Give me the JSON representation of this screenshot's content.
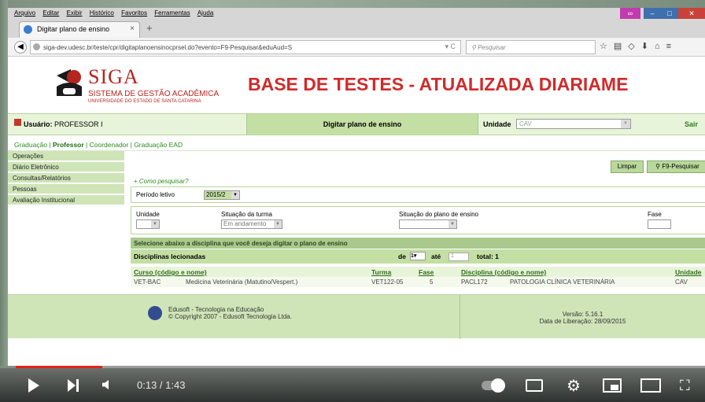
{
  "colors": {
    "brand_red": "#b52520",
    "banner_red": "#d12a2a",
    "green_light": "#e8f4d9",
    "green_mid": "#c3dfa3",
    "green_link": "#2e8b1e",
    "youtube_red": "#e62117"
  },
  "browser": {
    "menu": [
      "Arquivo",
      "Editar",
      "Exibir",
      "Histórico",
      "Favoritos",
      "Ferramentas",
      "Ajuda"
    ],
    "tab_title": "Digitar plano de ensino",
    "url": "siga-dev.udesc.br/teste/cpr/digitaplanoensinocprsel.do?evento=F9-Pesquisar&eduAud=S",
    "search_placeholder": "Pesquisar",
    "nav_icons": [
      "star-icon",
      "bookmarks-icon",
      "pocket-icon",
      "download-icon",
      "home-icon",
      "menu-icon"
    ]
  },
  "header": {
    "logo_title": "SIGA",
    "logo_subtitle": "SISTEMA DE GESTÃO ACADÊMICA",
    "logo_org": "UNIVERSIDADE DO ESTADO DE SANTA CATARINA",
    "banner": "BASE DE TESTES - ATUALIZADA DIARIAME"
  },
  "userbar": {
    "user_label": "Usuário:",
    "user_name": "PROFESSOR I",
    "title": "Digitar plano de ensino",
    "unidade_label": "Unidade",
    "unidade_value": "CAV",
    "logout": "Sair"
  },
  "profiles": {
    "graduacao": "Graduação",
    "professor": "Professor",
    "coordenador": "Coordenador",
    "ead": "Graduação EAD"
  },
  "sidebar": {
    "items": [
      {
        "label": "Operações"
      },
      {
        "label": "Diário Eletrônico"
      },
      {
        "label": "Consultas/Relatórios"
      },
      {
        "label": "Pessoas"
      },
      {
        "label": "Avaliação Institucional"
      }
    ]
  },
  "form": {
    "btn_limpar": "Limpar",
    "btn_pesquisar": "F9-Pesquisar",
    "help_link": "+ Como pesquisar?",
    "periodo_label": "Período letivo",
    "periodo_value": "2015/2",
    "unidade_label": "Unidade",
    "unidade_value": "",
    "situacao_turma_label": "Situação da turma",
    "situacao_turma_value": "Em andamento",
    "situacao_plano_label": "Situação do plano de ensino",
    "situacao_plano_value": "",
    "fase_label": "Fase",
    "fase_value": ""
  },
  "results": {
    "instruction": "Selecione abaixo a disciplina que você deseja digitar o plano de ensino",
    "section_title": "Disciplinas lecionadas",
    "pager_de": "de",
    "pager_from": "1",
    "pager_ate": "até",
    "pager_to": "1",
    "total_label": "total:",
    "total": "1",
    "columns": {
      "curso": "Curso (código e nome)",
      "turma": "Turma",
      "fase": "Fase",
      "disciplina": "Disciplina (código e nome)",
      "unidade": "Unidade"
    },
    "row": {
      "curso_code": "VET-BAC",
      "curso_name": "Medicina Veterinária (Matutino/Vespert.)",
      "turma": "VET122-05",
      "fase": "5",
      "disc_code": "PACL172",
      "disc_name": "PATOLOGIA CLÍNICA VETERINÁRIA",
      "unidade": "CAV"
    }
  },
  "footer": {
    "company": "Edusoft - Tecnologia na Educação",
    "copyright": "© Copyright 2007 - Edusoft Tecnologia Ltda.",
    "version": "Versão: 5.16.1",
    "release": "Data de Liberação: 28/09/2015"
  },
  "video": {
    "time": "0:13 / 1:43",
    "progress": 0.126
  }
}
